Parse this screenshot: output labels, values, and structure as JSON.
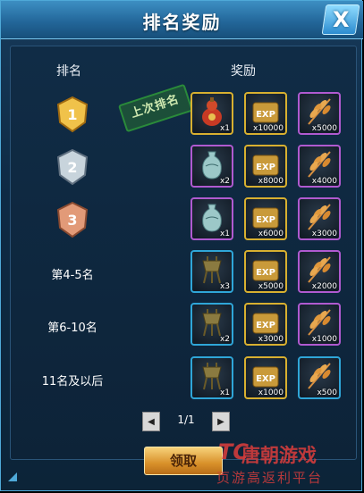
{
  "window": {
    "title": "排名奖励",
    "close_icon": "close-icon"
  },
  "headers": {
    "rank": "排名",
    "reward": "奖励"
  },
  "stamp_text": "上次排名",
  "rows": [
    {
      "rank_label": "1",
      "rank_icon": "gold-rank-badge",
      "rewards": [
        {
          "icon": "gourd-icon",
          "qty": "x1",
          "rarity": "gold"
        },
        {
          "icon": "exp-scroll-icon",
          "qty": "x10000",
          "rarity": "gold"
        },
        {
          "icon": "wheat-icon",
          "qty": "x5000",
          "rarity": "purple"
        }
      ]
    },
    {
      "rank_label": "2",
      "rank_icon": "silver-rank-badge",
      "rewards": [
        {
          "icon": "vase-icon",
          "qty": "x2",
          "rarity": "purple"
        },
        {
          "icon": "exp-scroll-icon",
          "qty": "x8000",
          "rarity": "gold"
        },
        {
          "icon": "wheat-icon",
          "qty": "x4000",
          "rarity": "purple"
        }
      ]
    },
    {
      "rank_label": "3",
      "rank_icon": "bronze-rank-badge",
      "rewards": [
        {
          "icon": "vase-icon",
          "qty": "x1",
          "rarity": "purple"
        },
        {
          "icon": "exp-scroll-icon",
          "qty": "x6000",
          "rarity": "gold"
        },
        {
          "icon": "wheat-icon",
          "qty": "x3000",
          "rarity": "purple"
        }
      ]
    },
    {
      "rank_label": "第4-5名",
      "rewards": [
        {
          "icon": "bronze-vessel-icon",
          "qty": "x3",
          "rarity": "blue"
        },
        {
          "icon": "exp-scroll-icon",
          "qty": "x5000",
          "rarity": "gold"
        },
        {
          "icon": "wheat-icon",
          "qty": "x2000",
          "rarity": "purple"
        }
      ]
    },
    {
      "rank_label": "第6-10名",
      "rewards": [
        {
          "icon": "bronze-vessel-icon",
          "qty": "x2",
          "rarity": "blue"
        },
        {
          "icon": "exp-scroll-icon",
          "qty": "x3000",
          "rarity": "gold"
        },
        {
          "icon": "wheat-icon",
          "qty": "x1000",
          "rarity": "purple"
        }
      ]
    },
    {
      "rank_label": "11名及以后",
      "rewards": [
        {
          "icon": "bronze-vessel-icon",
          "qty": "x1",
          "rarity": "blue"
        },
        {
          "icon": "exp-scroll-icon",
          "qty": "x1000",
          "rarity": "gold"
        },
        {
          "icon": "wheat-icon",
          "qty": "x500",
          "rarity": "blue"
        }
      ]
    }
  ],
  "pager": {
    "text": "1/1",
    "prev_icon": "prev-arrow-icon",
    "next_icon": "next-arrow-icon"
  },
  "claim_label": "领取",
  "watermark": {
    "logo": "TC",
    "main": "唐朝游戏",
    "sub": "页游高返利平台"
  },
  "colors": {
    "gold": "#d8b030",
    "purple": "#b05ad0",
    "blue": "#2fa6d8",
    "accent": "#3d8fc3"
  }
}
